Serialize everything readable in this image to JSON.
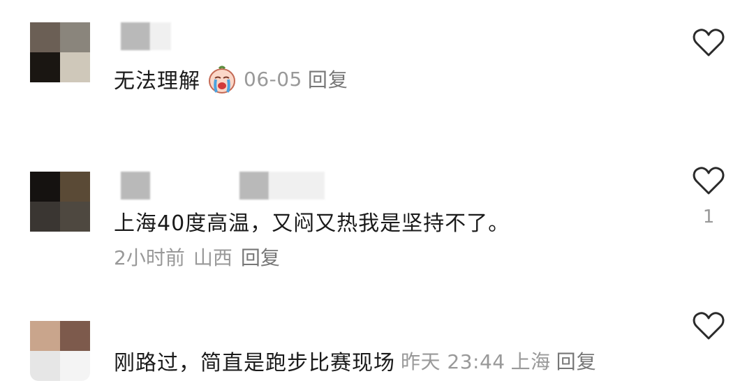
{
  "comments": [
    {
      "text": "无法理解",
      "emoji": "crying-emoji",
      "date": "06-05",
      "reply": "回复",
      "likes": "",
      "avatar_colors": [
        "#6b5f55",
        "#8a857c",
        "#1a1612",
        "#cfc8ba"
      ]
    },
    {
      "text": "上海40度高温，又闷又热我是坚持不了。",
      "time": "2小时前",
      "location": "山西",
      "reply": "回复",
      "likes": "1",
      "avatar_colors": [
        "#151210",
        "#5a4a36",
        "#3a3632",
        "#4e4840"
      ]
    },
    {
      "text": "刚路过，简直是跑步比赛现场",
      "time": "昨天 23:44",
      "location": "上海",
      "reply": "回复",
      "likes": "",
      "avatar_colors": [
        "#c9a58c",
        "#7d5a4c",
        "#e6e6e6",
        "#f4f4f4"
      ]
    }
  ],
  "icons": {
    "like": "heart-outline-icon"
  },
  "colors": {
    "text": "#1a1a1a",
    "meta": "#999999",
    "icon_stroke": "#2a2a2a"
  }
}
